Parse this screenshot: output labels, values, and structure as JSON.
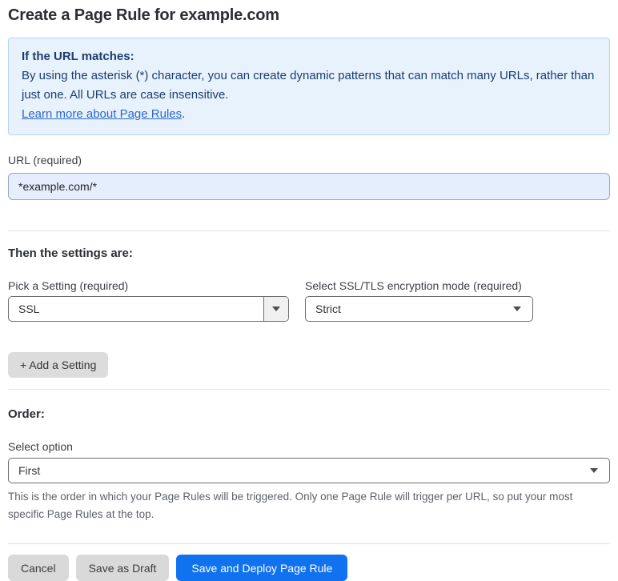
{
  "page": {
    "title": "Create a Page Rule for example.com"
  },
  "info_box": {
    "heading": "If the URL matches:",
    "body": "By using the asterisk (*) character, you can create dynamic patterns that can match many URLs, rather than just one. All URLs are case insensitive.",
    "link": "Learn more about Page Rules",
    "link_suffix": "."
  },
  "url_field": {
    "label": "URL (required)",
    "value": "*example.com/*"
  },
  "settings": {
    "heading": "Then the settings are:",
    "pick_setting": {
      "label": "Pick a Setting (required)",
      "value": "SSL"
    },
    "encryption_mode": {
      "label": "Select SSL/TLS encryption mode (required)",
      "value": "Strict"
    },
    "add_button_label": "+ Add a Setting"
  },
  "order": {
    "heading": "Order:",
    "label": "Select option",
    "value": "First",
    "help": "This is the order in which your Page Rules will be triggered. Only one Page Rule will trigger per URL, so put your most specific Page Rules at the top."
  },
  "footer": {
    "cancel_label": "Cancel",
    "save_draft_label": "Save as Draft",
    "save_deploy_label": "Save and Deploy Page Rule"
  },
  "colors": {
    "accent_blue": "#1172f0",
    "info_background": "#e8f2fc",
    "info_border": "#b3d4f1",
    "info_text": "#1b3d6e",
    "link_blue": "#2c67c8",
    "url_input_background": "#e4eefc"
  }
}
